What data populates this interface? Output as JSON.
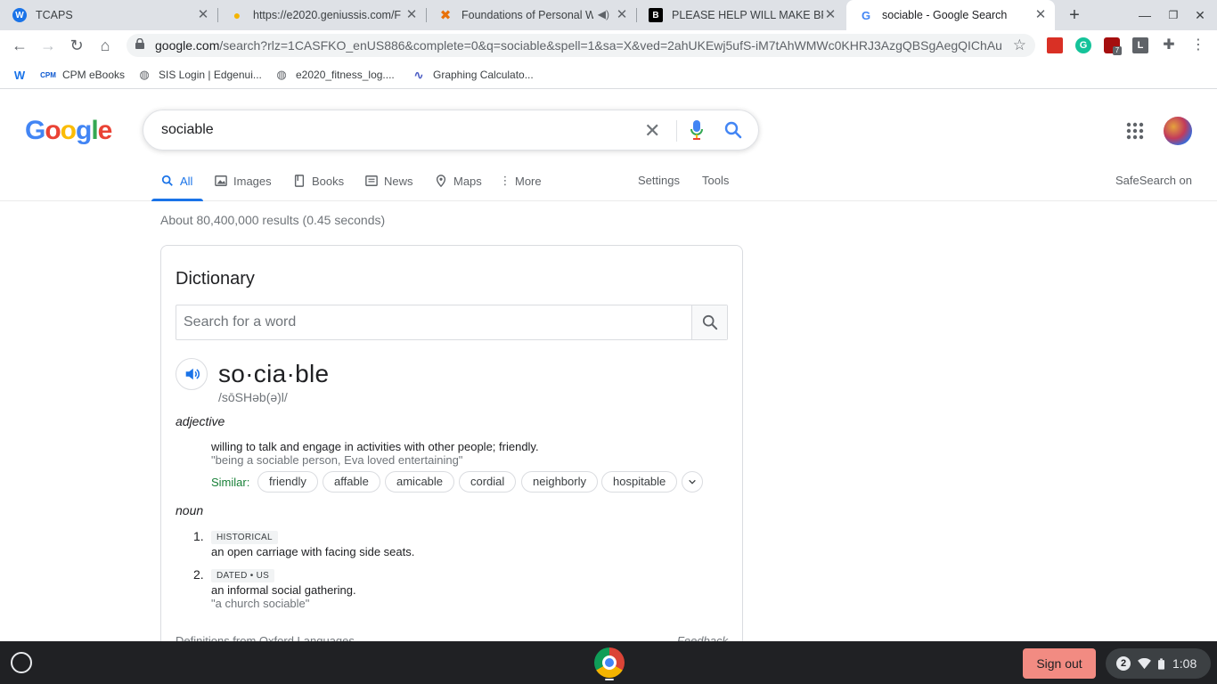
{
  "browser": {
    "tabs": [
      {
        "title": "TCAPS",
        "active": false
      },
      {
        "title": "https://e2020.geniussis.com/F",
        "active": false
      },
      {
        "title": "Foundations of Personal W",
        "active": false
      },
      {
        "title": "PLEASE HELP WILL MAKE BRA",
        "active": false
      },
      {
        "title": "sociable - Google Search",
        "active": true
      }
    ],
    "new_tab_label": "+",
    "url_host": "google.com",
    "url_path": "/search?rlz=1CASFKO_enUS886&complete=0&q=sociable&spell=1&sa=X&ved=2ahUKEwj5ufS-iM7tAhWMWc0KHRJ3AzgQBSgAegQIChAu...",
    "extension_badge": "7",
    "bookmarks": [
      {
        "label": "CPM eBooks"
      },
      {
        "label": "SIS Login | Edgenui..."
      },
      {
        "label": "e2020_fitness_log...."
      },
      {
        "label": "Graphing Calculato..."
      }
    ]
  },
  "search": {
    "query": "sociable",
    "tabs": [
      "All",
      "Images",
      "Books",
      "News",
      "Maps",
      "More"
    ],
    "settings_label": "Settings",
    "tools_label": "Tools",
    "safesearch": "SafeSearch on",
    "result_stats": "About 80,400,000 results (0.45 seconds)"
  },
  "dictionary": {
    "title": "Dictionary",
    "search_placeholder": "Search for a word",
    "headword": "so·cia·ble",
    "phonetic": "/sōSHəb(ə)l/",
    "adjective": {
      "pos": "adjective",
      "definition": "willing to talk and engage in activities with other people; friendly.",
      "example": "\"being a sociable person, Eva loved entertaining\"",
      "similar_label": "Similar:",
      "similar": [
        "friendly",
        "affable",
        "amicable",
        "cordial",
        "neighborly",
        "hospitable"
      ]
    },
    "noun": {
      "pos": "noun",
      "senses": [
        {
          "num": "1.",
          "tag": "HISTORICAL",
          "definition": "an open carriage with facing side seats.",
          "example": ""
        },
        {
          "num": "2.",
          "tag": "DATED • US",
          "definition": "an informal social gathering.",
          "example": "\"a church sociable\""
        }
      ]
    },
    "source": "Definitions from Oxford Languages",
    "feedback": "Feedback"
  },
  "shelf": {
    "signout_label": "Sign out",
    "notification_count": "2",
    "time": "1:08"
  }
}
